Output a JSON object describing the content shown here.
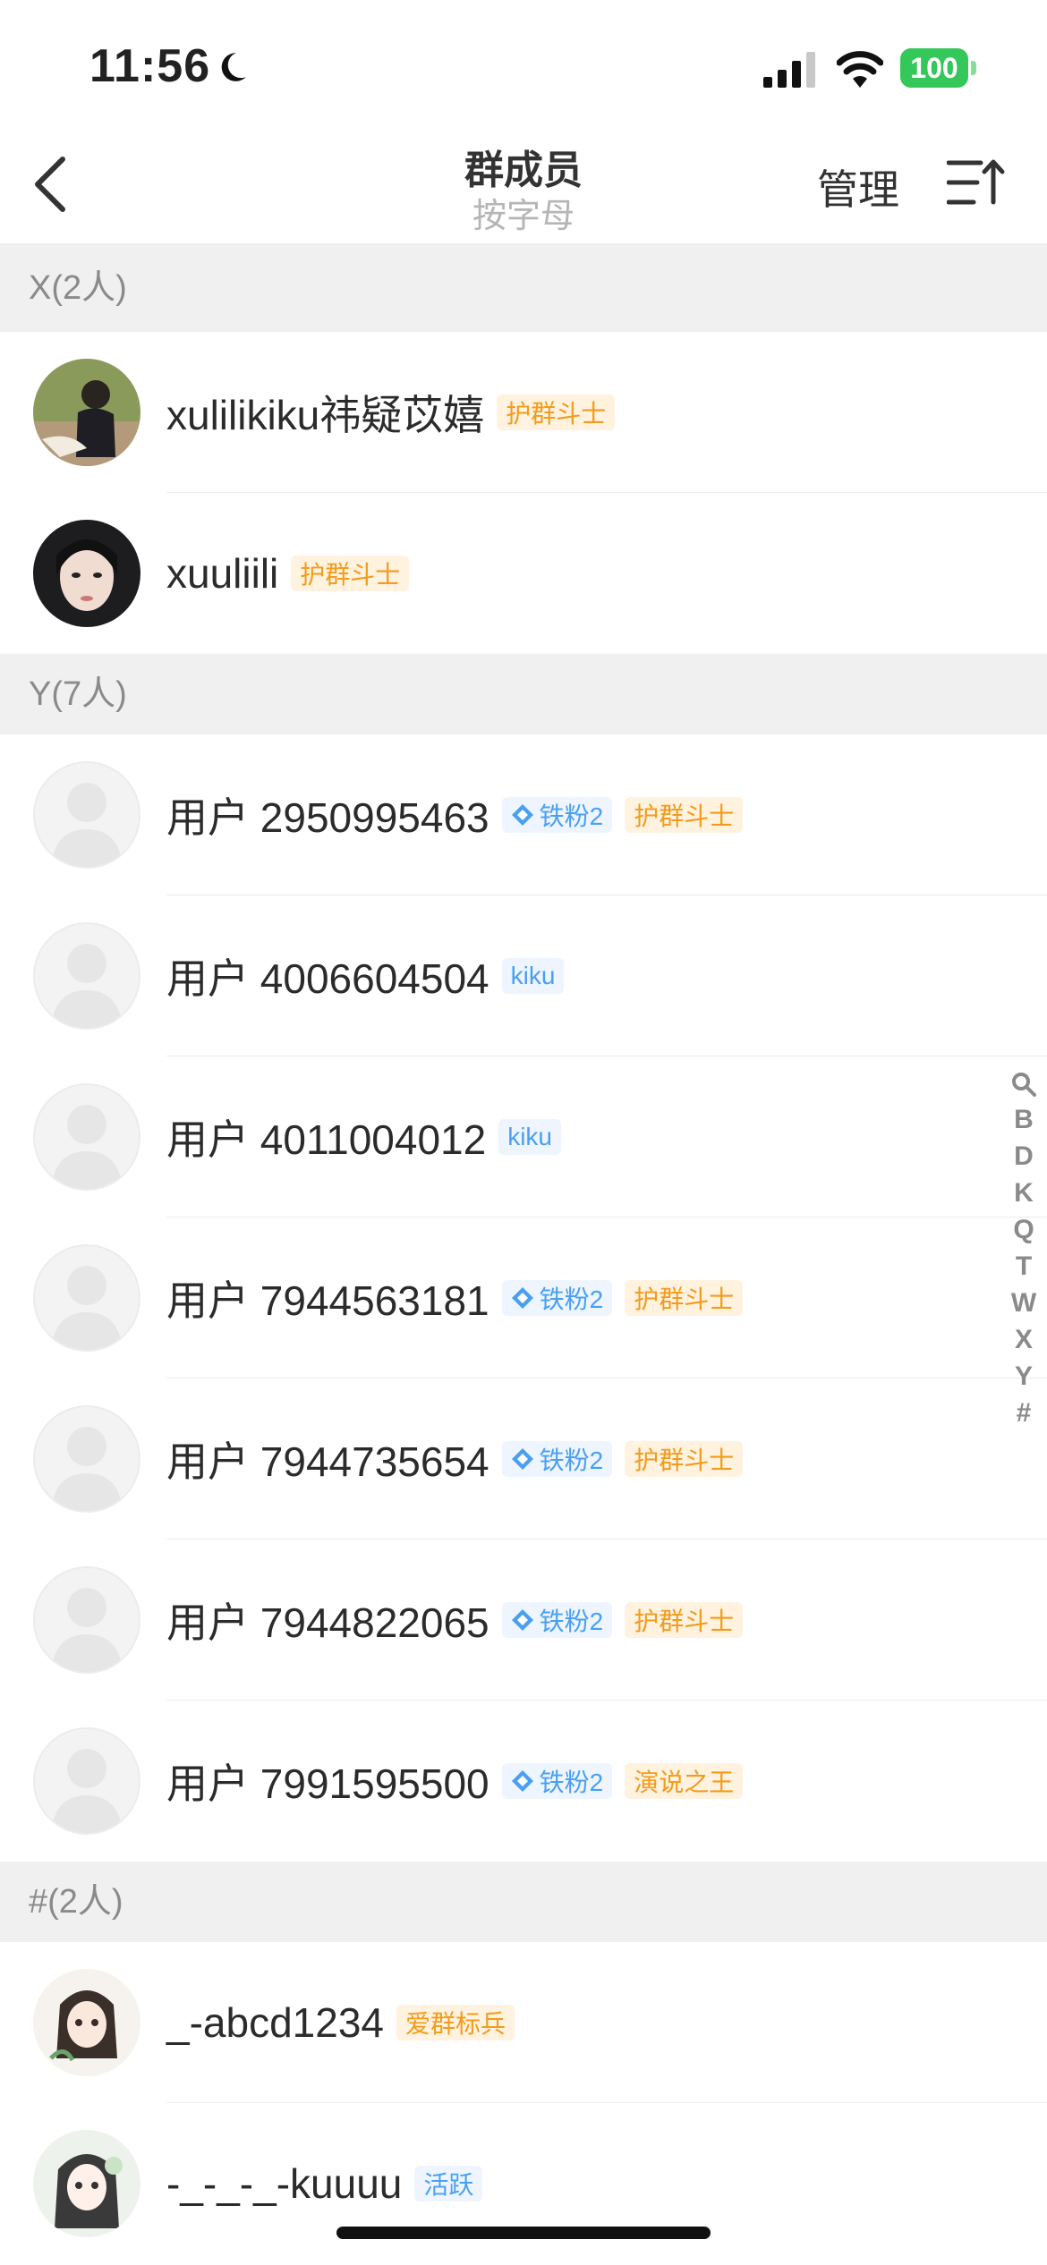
{
  "status": {
    "time": "11:56",
    "battery": "100"
  },
  "nav": {
    "title": "群成员",
    "subtitle": "按字母",
    "manage": "管理"
  },
  "sections": [
    {
      "header": "X(2人)"
    },
    {
      "header": "Y(7人)"
    },
    {
      "header": "#(2人)"
    }
  ],
  "members": [
    {
      "name": "xulilikiku祎疑苡嬉",
      "badges": [
        "护群斗士"
      ]
    },
    {
      "name": "xuuliili",
      "badges": [
        "护群斗士"
      ]
    },
    {
      "name": "用户 2950995463",
      "badges": [
        "铁粉2",
        "护群斗士"
      ]
    },
    {
      "name": "用户 4006604504",
      "badges": [
        "kiku"
      ]
    },
    {
      "name": "用户 4011004012",
      "badges": [
        "kiku"
      ]
    },
    {
      "name": "用户 7944563181",
      "badges": [
        "铁粉2",
        "护群斗士"
      ]
    },
    {
      "name": "用户 7944735654",
      "badges": [
        "铁粉2",
        "护群斗士"
      ]
    },
    {
      "name": "用户 7944822065",
      "badges": [
        "铁粉2",
        "护群斗士"
      ]
    },
    {
      "name": "用户 7991595500",
      "badges": [
        "铁粉2",
        "演说之王"
      ]
    },
    {
      "name": "_-abcd1234",
      "badges": [
        "爱群标兵"
      ]
    },
    {
      "name": "-_-_-_-kuuuu",
      "badges": [
        "活跃"
      ]
    }
  ],
  "index": [
    "B",
    "D",
    "K",
    "Q",
    "T",
    "W",
    "X",
    "Y",
    "#"
  ],
  "colors": {
    "badge_orange": "#f39b1c",
    "badge_blue": "#4aa0f0",
    "battery": "#34c759"
  }
}
